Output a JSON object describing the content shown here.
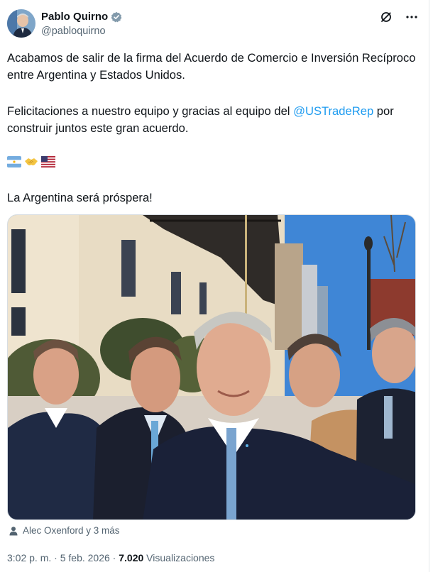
{
  "post": {
    "author_name": "Pablo Quirno",
    "author_handle": "@pabloquirno",
    "paragraph1": "Acabamos de salir de la firma del Acuerdo de Comercio e Inversión Recíproco entre Argentina y Estados Unidos.",
    "paragraph2_pre": "Felicitaciones a nuestro equipo y gracias al equipo del ",
    "mention": "@USTradeRep",
    "paragraph2_post": " por construir juntos este gran acuerdo.",
    "paragraph3": "La Argentina será próspera!",
    "emojis": [
      "argentina-flag",
      "handshake",
      "us-flag"
    ]
  },
  "tagged": "Alec Oxenford y 3 más",
  "meta": {
    "time": "3:02 p. m.",
    "separator": " · ",
    "date": "5 feb. 2026",
    "views_count": "7.020",
    "views_label": "Visualizaciones"
  },
  "colors": {
    "accent": "#1d9bf0",
    "muted": "#536471",
    "text": "#0f1419"
  }
}
